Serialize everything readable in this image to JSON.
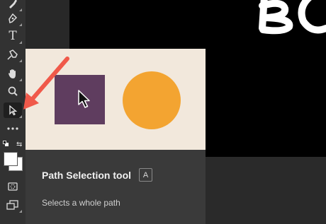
{
  "toolbar": {
    "tools": [
      {
        "name": "pen-tool",
        "icon": "pen-icon"
      },
      {
        "name": "type-tool",
        "icon": "type-icon",
        "glyph": "T"
      },
      {
        "name": "puppet-warp-tool",
        "icon": "pin-icon"
      },
      {
        "name": "hand-tool",
        "icon": "hand-icon"
      },
      {
        "name": "zoom-tool",
        "icon": "magnifier-icon"
      },
      {
        "name": "path-selection-tool",
        "icon": "arrow-cursor-icon",
        "selected": true
      },
      {
        "name": "more-tools",
        "icon": "ellipsis-icon"
      },
      {
        "name": "color-swatches",
        "icon": "swatch-icon"
      },
      {
        "name": "quick-mask",
        "icon": "quick-mask-icon"
      },
      {
        "name": "screen-mode",
        "icon": "screen-mode-icon"
      }
    ]
  },
  "tooltip": {
    "title": "Path Selection tool",
    "shortcut": "A",
    "description": "Selects a whole path"
  },
  "colors": {
    "tooltip_preview_bg": "#f2e8dc",
    "square": "#5f3d5f",
    "circle": "#f3a431",
    "callout_arrow": "#f0594a"
  }
}
